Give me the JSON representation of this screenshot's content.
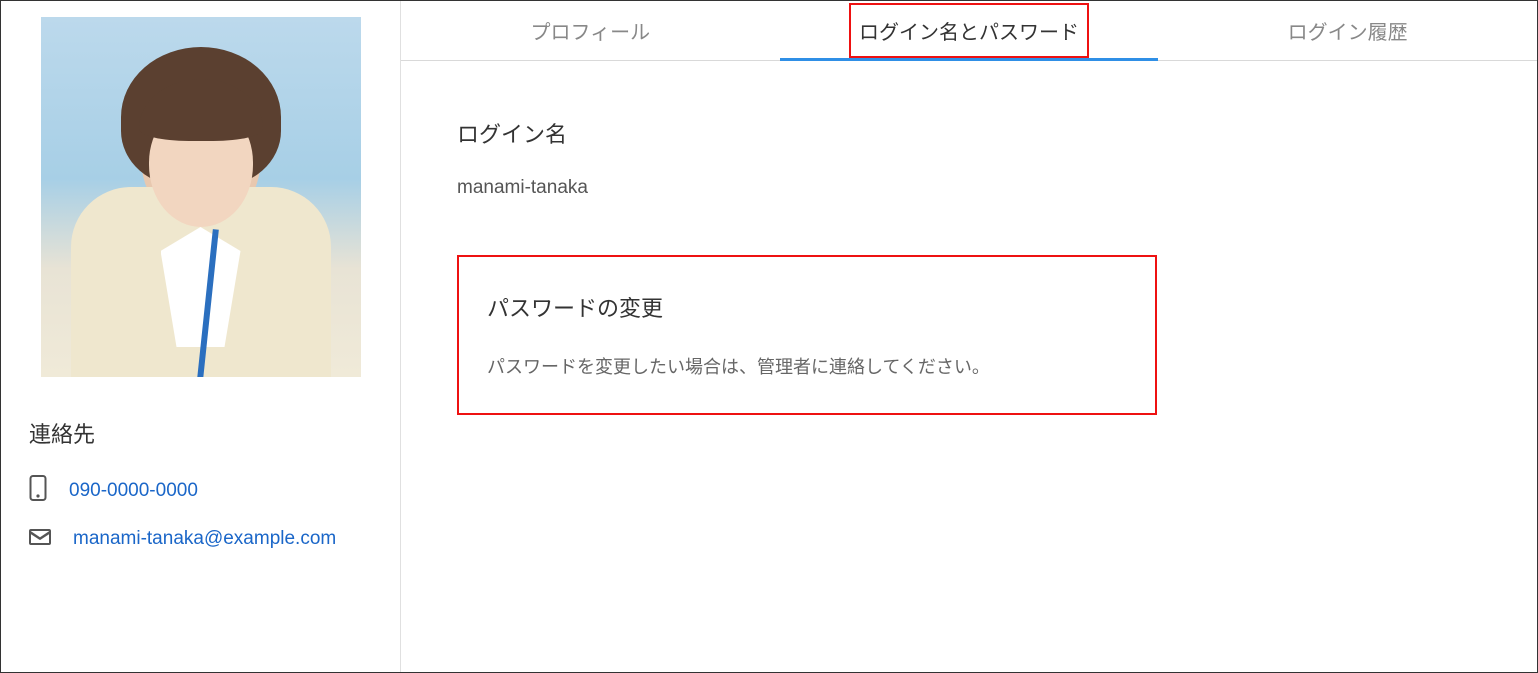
{
  "sidebar": {
    "contact_heading": "連絡先",
    "phone": "090-0000-0000",
    "email": "manami-tanaka@example.com"
  },
  "tabs": {
    "profile": "プロフィール",
    "login": "ログイン名とパスワード",
    "history": "ログイン履歴"
  },
  "main": {
    "login_name_label": "ログイン名",
    "login_name_value": "manami-tanaka",
    "password_change_title": "パスワードの変更",
    "password_change_text": "パスワードを変更したい場合は、管理者に連絡してください。"
  }
}
